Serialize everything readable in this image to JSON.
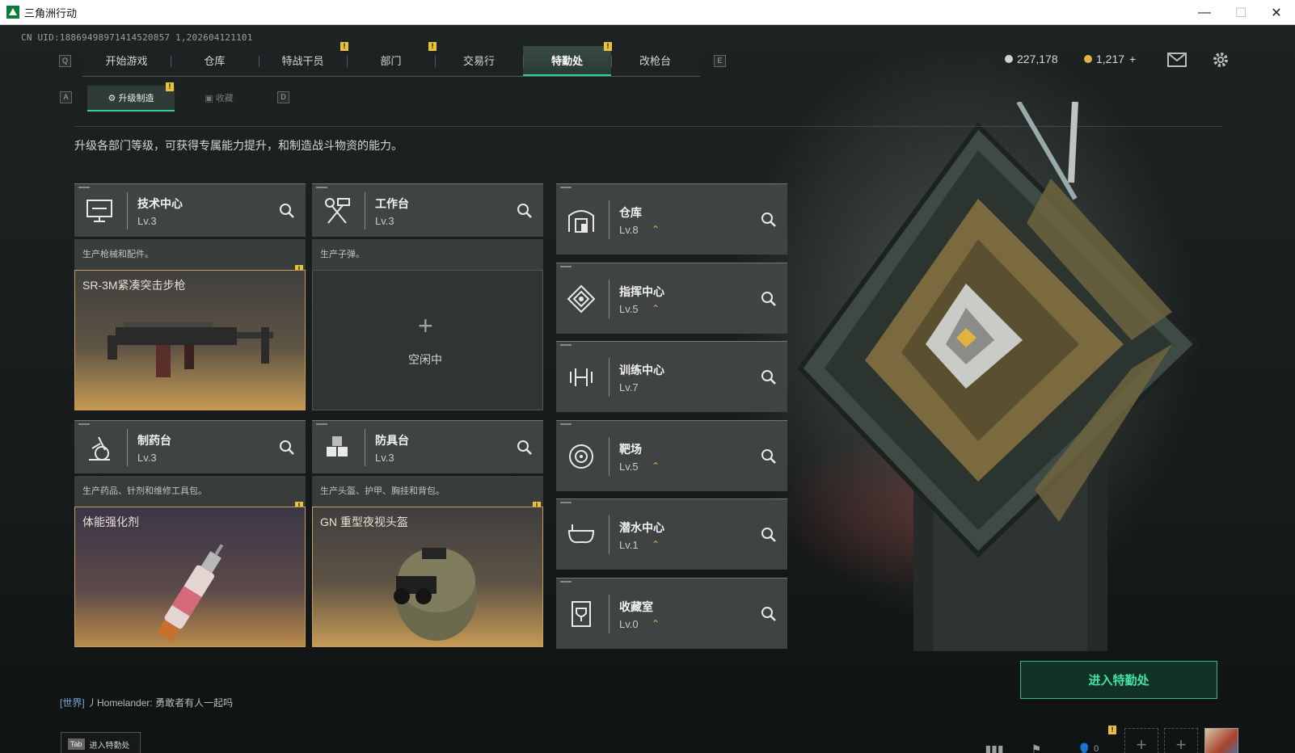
{
  "window": {
    "title": "三角洲行动",
    "minimize": "—",
    "maximize": "☐",
    "close": "✕"
  },
  "uid": "CN UID:18869498971414520857 1,202604121101",
  "nav": {
    "key_left": "Q",
    "key_right": "E",
    "tabs": [
      {
        "label": "开始游戏",
        "active": false,
        "alert": false
      },
      {
        "label": "仓库",
        "active": false,
        "alert": false
      },
      {
        "label": "特战干员",
        "active": false,
        "alert": true
      },
      {
        "label": "部门",
        "active": false,
        "alert": true
      },
      {
        "label": "交易行",
        "active": false,
        "alert": false
      },
      {
        "label": "特勤处",
        "active": true,
        "alert": true
      },
      {
        "label": "改枪台",
        "active": false,
        "alert": false
      }
    ]
  },
  "subtabs": {
    "key_left": "A",
    "key_right": "D",
    "upgrade": "升级制造",
    "collect": "收藏"
  },
  "currency": {
    "silver": "227,178",
    "gold": "1,217",
    "gold_add": "+"
  },
  "alert_mark": "!",
  "description": "升级各部门等级，可获得专属能力提升，和制造战斗物资的能力。",
  "left_departments": [
    {
      "name": "技术中心",
      "level": "Lv.3",
      "desc": "生产枪械和配件。",
      "icon": "monitor-icon",
      "product": "SR-3M紧凑突击步枪",
      "product_kind": "rifle",
      "alert": true
    },
    {
      "name": "工作台",
      "level": "Lv.3",
      "desc": "生产子弹。",
      "icon": "hammer-wrench-icon",
      "product": "",
      "product_kind": "empty",
      "alert": false
    },
    {
      "name": "制药台",
      "level": "Lv.3",
      "desc": "生产药品、针剂和维修工具包。",
      "icon": "microscope-icon",
      "product": "体能强化剂",
      "product_kind": "syringe",
      "alert": true
    },
    {
      "name": "防具台",
      "level": "Lv.3",
      "desc": "生产头盔、护甲、胸挂和背包。",
      "icon": "cubes-icon",
      "product": "GN 重型夜视头盔",
      "product_kind": "helmet",
      "alert": true
    }
  ],
  "idle": {
    "plus": "+",
    "label": "空闲中"
  },
  "right_departments": [
    {
      "name": "仓库",
      "level": "Lv.8",
      "upgradable": true,
      "icon": "vault-icon"
    },
    {
      "name": "指挥中心",
      "level": "Lv.5",
      "upgradable": true,
      "icon": "command-icon"
    },
    {
      "name": "训练中心",
      "level": "Lv.7",
      "upgradable": false,
      "icon": "dumbbell-icon"
    },
    {
      "name": "靶场",
      "level": "Lv.5",
      "upgradable": true,
      "icon": "target-icon"
    },
    {
      "name": "潜水中心",
      "level": "Lv.1",
      "upgradable": true,
      "icon": "goggles-icon"
    },
    {
      "name": "收藏室",
      "level": "Lv.0",
      "upgradable": true,
      "icon": "trophy-icon"
    }
  ],
  "upgrade_glyph": "⌃",
  "enter_button": "进入特勤处",
  "chat": {
    "channel": "[世界]",
    "user": "丿Homelander:",
    "message": "勇敢者有人一起吗"
  },
  "tab_hint": {
    "key": "Tab",
    "label": "进入特勤处"
  },
  "bottom": {
    "friends_count": "0",
    "slot_plus": "+"
  },
  "colors": {
    "accent": "#2fd39a",
    "alert": "#e8c23a",
    "product_border": "#c79c5a"
  }
}
